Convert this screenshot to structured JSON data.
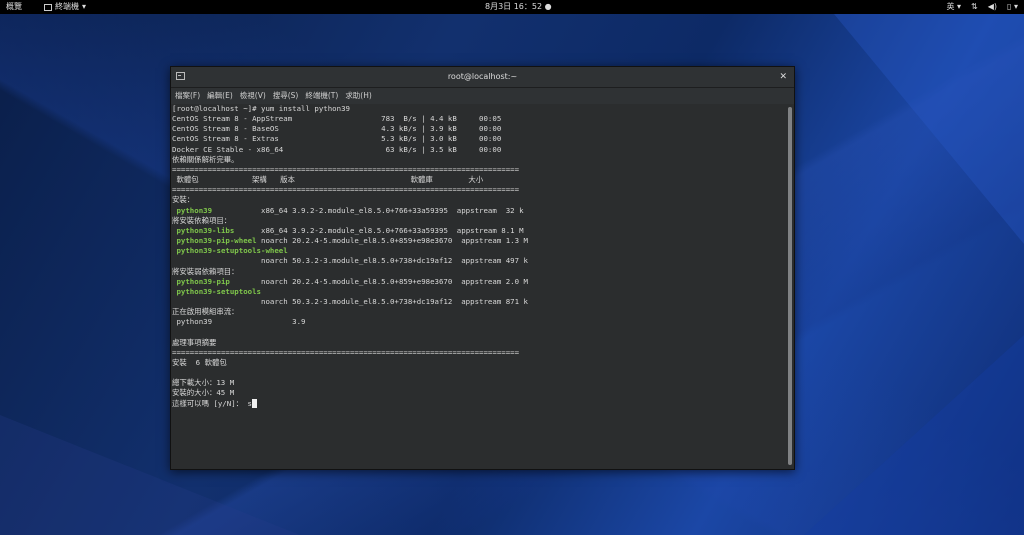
{
  "topbar": {
    "activities": "概覽",
    "app_menu": "終端機",
    "clock": "8月3日  16：52",
    "input_method": "英",
    "app_menu_icon": "terminal-icon",
    "dropdown_icon": "chevron-down-icon",
    "clock_dot_icon": "notification-dot-icon",
    "network_icon": "network-icon",
    "volume_icon": "volume-icon",
    "battery_icon": "battery-icon"
  },
  "window": {
    "title": "root@localhost:~",
    "close_icon": "close-icon",
    "menu": [
      "檔案(F)",
      "編輯(E)",
      "檢視(V)",
      "搜尋(S)",
      "終端機(T)",
      "求助(H)"
    ]
  },
  "terminal": {
    "lines": [
      [
        {
          "t": "[root@localhost ~]# yum install python39"
        }
      ],
      [
        {
          "t": "CentOS Stream 8 - AppStream                    783  B/s | 4.4 kB     00:05"
        }
      ],
      [
        {
          "t": "CentOS Stream 8 - BaseOS                       4.3 kB/s | 3.9 kB     00:00"
        }
      ],
      [
        {
          "t": "CentOS Stream 8 - Extras                       5.3 kB/s | 3.0 kB     00:00"
        }
      ],
      [
        {
          "t": "Docker CE Stable - x86_64                       63 kB/s | 3.5 kB     00:00"
        }
      ],
      [
        {
          "t": "依賴關係解析完畢。"
        }
      ],
      [
        {
          "t": "=============================================================================="
        }
      ],
      [
        {
          "t": " 軟體包            架構   版本                          軟體庫        大小"
        }
      ],
      [
        {
          "t": "=============================================================================="
        }
      ],
      [
        {
          "t": "安裝："
        }
      ],
      [
        {
          "t": " "
        },
        {
          "t": "python39",
          "g": true
        },
        {
          "t": "           x86_64 3.9.2-2.module_el8.5.0+766+33a59395  appstream  32 k"
        }
      ],
      [
        {
          "t": "將安裝依賴項目："
        }
      ],
      [
        {
          "t": " "
        },
        {
          "t": "python39-libs",
          "g": true
        },
        {
          "t": "      x86_64 3.9.2-2.module_el8.5.0+766+33a59395  appstream 8.1 M"
        }
      ],
      [
        {
          "t": " "
        },
        {
          "t": "python39-pip-wheel",
          "g": true
        },
        {
          "t": " noarch 20.2.4-5.module_el8.5.0+859+e98e3670  appstream 1.3 M"
        }
      ],
      [
        {
          "t": " "
        },
        {
          "t": "python39-setuptools-wheel",
          "g": true
        }
      ],
      [
        {
          "t": "                    noarch 50.3.2-3.module_el8.5.0+738+dc19af12  appstream 497 k"
        }
      ],
      [
        {
          "t": "將安裝弱依賴項目："
        }
      ],
      [
        {
          "t": " "
        },
        {
          "t": "python39-pip",
          "g": true
        },
        {
          "t": "       noarch 20.2.4-5.module_el8.5.0+859+e98e3670  appstream 2.0 M"
        }
      ],
      [
        {
          "t": " "
        },
        {
          "t": "python39-setuptools",
          "g": true
        }
      ],
      [
        {
          "t": "                    noarch 50.3.2-3.module_el8.5.0+738+dc19af12  appstream 871 k"
        }
      ],
      [
        {
          "t": "正在啟用模組串流："
        }
      ],
      [
        {
          "t": " python39                  3.9"
        }
      ],
      [
        {
          "t": ""
        }
      ],
      [
        {
          "t": "處理事項摘要"
        }
      ],
      [
        {
          "t": "=============================================================================="
        }
      ],
      [
        {
          "t": "安裝  6 軟體包"
        }
      ],
      [
        {
          "t": ""
        }
      ],
      [
        {
          "t": "總下載大小：13 M"
        }
      ],
      [
        {
          "t": "安裝的大小：45 M"
        }
      ],
      [
        {
          "t": "這樣可以嗎 [y/N]： s"
        }
      ]
    ]
  }
}
